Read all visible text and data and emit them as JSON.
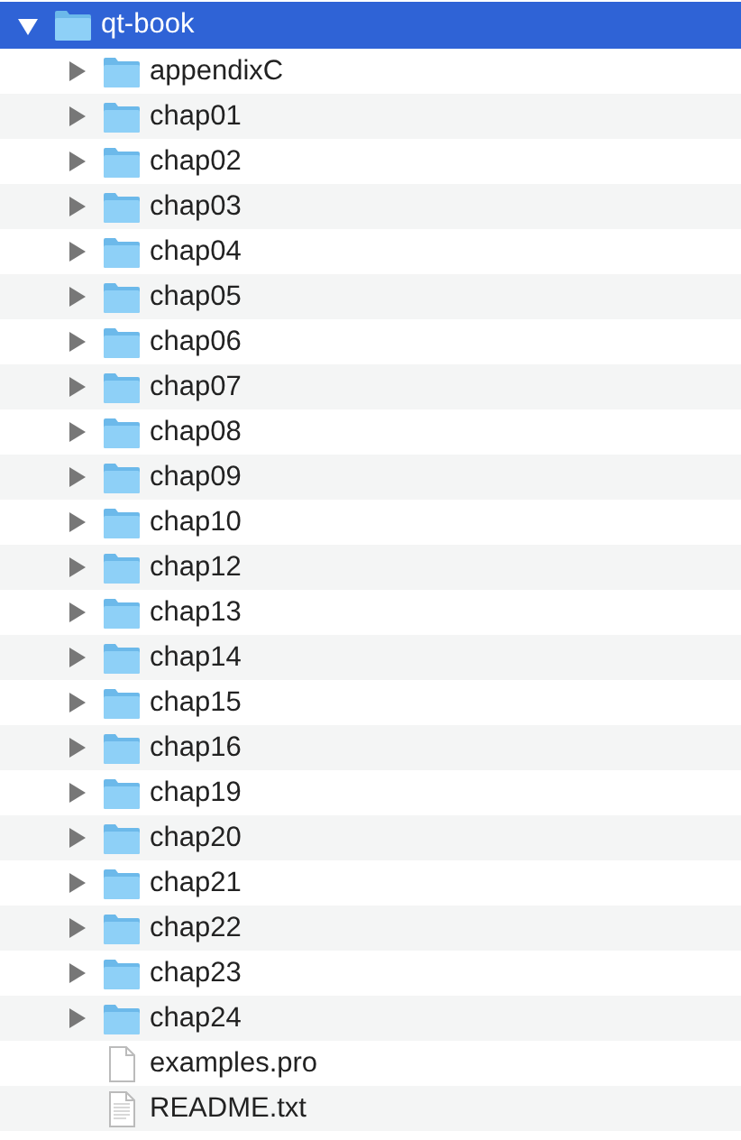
{
  "tree": [
    {
      "label": "qt-book",
      "kind": "folder",
      "expanded": true,
      "selected": true,
      "children": [
        {
          "label": "appendixC",
          "kind": "folder",
          "expanded": false,
          "selected": false
        },
        {
          "label": "chap01",
          "kind": "folder",
          "expanded": false,
          "selected": false
        },
        {
          "label": "chap02",
          "kind": "folder",
          "expanded": false,
          "selected": false
        },
        {
          "label": "chap03",
          "kind": "folder",
          "expanded": false,
          "selected": false
        },
        {
          "label": "chap04",
          "kind": "folder",
          "expanded": false,
          "selected": false
        },
        {
          "label": "chap05",
          "kind": "folder",
          "expanded": false,
          "selected": false
        },
        {
          "label": "chap06",
          "kind": "folder",
          "expanded": false,
          "selected": false
        },
        {
          "label": "chap07",
          "kind": "folder",
          "expanded": false,
          "selected": false
        },
        {
          "label": "chap08",
          "kind": "folder",
          "expanded": false,
          "selected": false
        },
        {
          "label": "chap09",
          "kind": "folder",
          "expanded": false,
          "selected": false
        },
        {
          "label": "chap10",
          "kind": "folder",
          "expanded": false,
          "selected": false
        },
        {
          "label": "chap12",
          "kind": "folder",
          "expanded": false,
          "selected": false
        },
        {
          "label": "chap13",
          "kind": "folder",
          "expanded": false,
          "selected": false
        },
        {
          "label": "chap14",
          "kind": "folder",
          "expanded": false,
          "selected": false
        },
        {
          "label": "chap15",
          "kind": "folder",
          "expanded": false,
          "selected": false
        },
        {
          "label": "chap16",
          "kind": "folder",
          "expanded": false,
          "selected": false
        },
        {
          "label": "chap19",
          "kind": "folder",
          "expanded": false,
          "selected": false
        },
        {
          "label": "chap20",
          "kind": "folder",
          "expanded": false,
          "selected": false
        },
        {
          "label": "chap21",
          "kind": "folder",
          "expanded": false,
          "selected": false
        },
        {
          "label": "chap22",
          "kind": "folder",
          "expanded": false,
          "selected": false
        },
        {
          "label": "chap23",
          "kind": "folder",
          "expanded": false,
          "selected": false
        },
        {
          "label": "chap24",
          "kind": "folder",
          "expanded": false,
          "selected": false
        },
        {
          "label": "examples.pro",
          "kind": "file",
          "selected": false
        },
        {
          "label": "README.txt",
          "kind": "text",
          "selected": false
        }
      ]
    }
  ]
}
